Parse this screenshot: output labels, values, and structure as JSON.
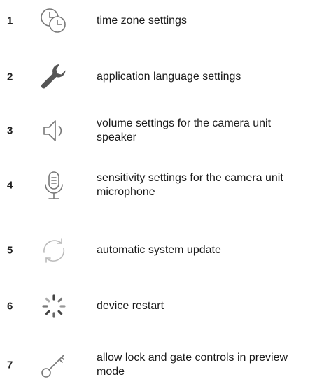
{
  "rows": [
    {
      "number": "1",
      "icon": "time-zone-clocks-icon",
      "text": "time zone settings"
    },
    {
      "number": "2",
      "icon": "wrench-icon",
      "text": "application language settings"
    },
    {
      "number": "3",
      "icon": "speaker-icon",
      "text": "volume settings for the camera unit speaker"
    },
    {
      "number": "4",
      "icon": "microphone-icon",
      "text": "sensitivity settings for the camera unit microphone"
    },
    {
      "number": "5",
      "icon": "refresh-icon",
      "text": "automatic system update"
    },
    {
      "number": "6",
      "icon": "restart-spinner-icon",
      "text": "device restart"
    },
    {
      "number": "7",
      "icon": "key-icon",
      "text": "allow lock and gate controls in preview mode"
    }
  ],
  "colors": {
    "icon_stroke": "#777777",
    "wrench_fill": "#555555",
    "refresh_stroke": "#bbbbbb",
    "divider": "#6f6f6f"
  }
}
